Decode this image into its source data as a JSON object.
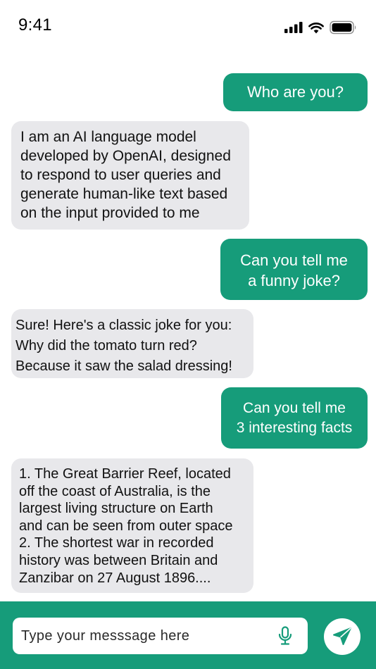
{
  "status_bar": {
    "time": "9:41",
    "icons": [
      "cellular-signal-icon",
      "wifi-icon",
      "battery-icon"
    ]
  },
  "colors": {
    "accent": "#169c7a",
    "bot_bubble": "#e8e8eb",
    "user_text": "#ffffff",
    "bot_text": "#111111"
  },
  "messages": [
    {
      "sender": "user",
      "text": "Who are you?"
    },
    {
      "sender": "bot",
      "text": "I am an AI language model\ndeveloped by OpenAI, designed\nto respond to user queries and\ngenerate human-like text based\n on the input provided to me"
    },
    {
      "sender": "user",
      "text": "Can you tell me\na funny joke?"
    },
    {
      "sender": "bot",
      "text": "Sure! Here's a classic joke for you:\nWhy did the tomato turn red?\nBecause it saw the salad dressing!"
    },
    {
      "sender": "user",
      "text": "Can you tell me\n3 interesting facts"
    },
    {
      "sender": "bot",
      "text": "1. The Great Barrier Reef, located\noff the coast of Australia, is the\nlargest living structure on Earth\nand can be seen from outer space\n2. The shortest war in recorded\nhistory was between Britain and\nZanzibar on 27 August 1896...."
    }
  ],
  "composer": {
    "placeholder": "Type your messsage here",
    "value": "",
    "mic_icon": "microphone-icon",
    "send_icon": "send-icon"
  }
}
